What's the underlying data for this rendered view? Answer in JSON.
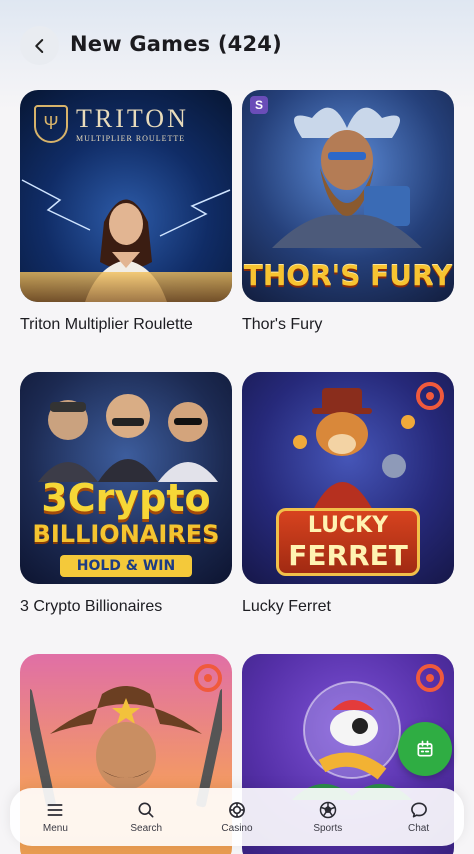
{
  "header": {
    "title": "New Games (424)"
  },
  "games": [
    {
      "name": "Triton Multiplier Roulette",
      "art_title": "TRITON",
      "art_subtitle": "MULTIPLIER ROULETTE"
    },
    {
      "name": "Thor's Fury",
      "art_title": "THOR'S FURY"
    },
    {
      "name": "3 Crypto Billionaires",
      "art_title": "3Crypto",
      "art_title2": "BILLIONAIRES",
      "art_badge": "HOLD & WIN"
    },
    {
      "name": "Lucky Ferret",
      "art_title": "LUCKY",
      "art_title2": "FERRET"
    },
    {
      "name": "",
      "art_title": ""
    },
    {
      "name": "",
      "art_title": ""
    }
  ],
  "bottom_nav": {
    "items": [
      {
        "label": "Menu",
        "icon": "menu-icon"
      },
      {
        "label": "Search",
        "icon": "search-icon"
      },
      {
        "label": "Casino",
        "icon": "casino-chip-icon"
      },
      {
        "label": "Sports",
        "icon": "soccer-ball-icon"
      },
      {
        "label": "Chat",
        "icon": "chat-bubble-icon"
      }
    ]
  },
  "fab": {
    "icon": "calendar-icon"
  },
  "colors": {
    "fab_green": "#2fad43",
    "badge_orange": "#f05a3c"
  }
}
